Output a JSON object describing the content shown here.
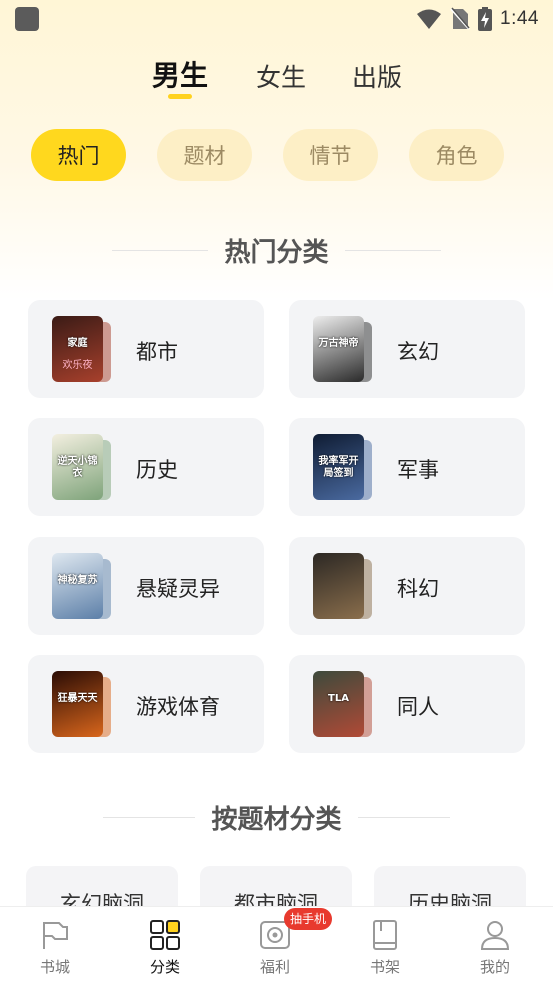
{
  "status": {
    "time": "1:44"
  },
  "top_tabs": [
    {
      "label": "男生",
      "active": true
    },
    {
      "label": "女生",
      "active": false
    },
    {
      "label": "出版",
      "active": false
    }
  ],
  "chips": [
    {
      "label": "热门",
      "active": true
    },
    {
      "label": "题材",
      "active": false
    },
    {
      "label": "情节",
      "active": false
    },
    {
      "label": "角色",
      "active": false
    }
  ],
  "hot_section": {
    "title": "热门分类",
    "cards": [
      {
        "label": "都市",
        "cover_text": [
          "家庭",
          "欢乐夜"
        ],
        "cover_colors": [
          "#3a1b16",
          "#a8402c"
        ]
      },
      {
        "label": "玄幻",
        "cover_text": [
          "万古神帝"
        ],
        "cover_colors": [
          "#eeeeee",
          "#2a2a2a"
        ]
      },
      {
        "label": "历史",
        "cover_text": [
          "逆天小锦衣"
        ],
        "cover_colors": [
          "#f3efe0",
          "#7ea37a"
        ]
      },
      {
        "label": "军事",
        "cover_text": [
          "我率军开局签到"
        ],
        "cover_colors": [
          "#0f1c33",
          "#4a6aa0"
        ]
      },
      {
        "label": "悬疑灵异",
        "cover_text": [
          "神秘复苏"
        ],
        "cover_colors": [
          "#dfe8f0",
          "#5c7fa8"
        ]
      },
      {
        "label": "科幻",
        "cover_text": [
          ""
        ],
        "cover_colors": [
          "#2c2824",
          "#8a6e4c"
        ]
      },
      {
        "label": "游戏体育",
        "cover_text": [
          "狂暴天天"
        ],
        "cover_colors": [
          "#2a0c05",
          "#d9661c"
        ]
      },
      {
        "label": "同人",
        "cover_text": [
          "TLA"
        ],
        "cover_colors": [
          "#3d4a3c",
          "#b14a36"
        ]
      }
    ]
  },
  "topic_section": {
    "title": "按题材分类",
    "tags": [
      "玄幻脑洞",
      "都市脑洞",
      "历史脑洞"
    ]
  },
  "bottom_nav": [
    {
      "label": "书城",
      "icon": "flag-icon",
      "active": false
    },
    {
      "label": "分类",
      "icon": "grid-icon",
      "active": true
    },
    {
      "label": "福利",
      "icon": "gift-camera-icon",
      "active": false
    },
    {
      "label": "书架",
      "icon": "book-icon",
      "active": false
    },
    {
      "label": "我的",
      "icon": "person-icon",
      "active": false
    }
  ],
  "welfare_badge": "抽手机",
  "colors": {
    "accent": "#FFD81E",
    "chip_bg": "#FDEFC6",
    "card_bg": "#F3F4F6",
    "badge": "#E83A2E"
  }
}
